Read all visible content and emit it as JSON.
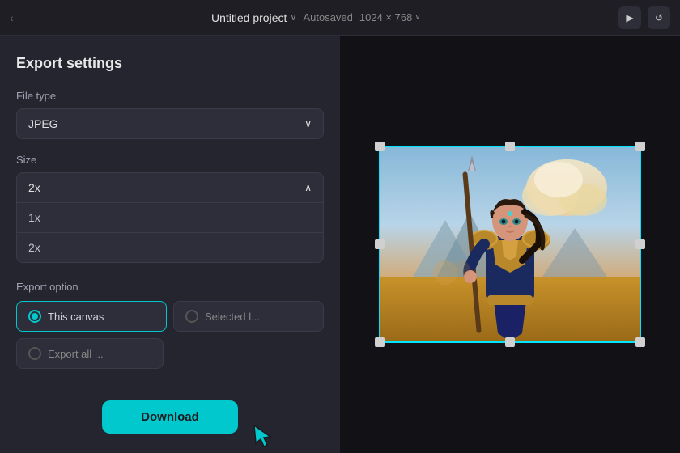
{
  "topbar": {
    "back_chevron": "‹",
    "project_name": "Untitled project",
    "project_chevron": "∨",
    "autosaved": "Autosaved",
    "canvas_size": "1024 × 768",
    "canvas_size_chevron": "∨"
  },
  "panel": {
    "title": "Export settings",
    "file_type_label": "File type",
    "file_type_value": "JPEG",
    "size_label": "Size",
    "size_value": "2x",
    "size_options": [
      {
        "label": "1x"
      },
      {
        "label": "2x"
      }
    ],
    "export_option_label": "Export option",
    "option_canvas": "This canvas",
    "option_selected": "Selected l...",
    "option_export_all": "Export all ..."
  },
  "download_btn": {
    "label": "Download"
  },
  "icons": {
    "chevron_down": "∨",
    "chevron_up": "∧",
    "radio_checked": "●",
    "play": "▶",
    "rotate": "↺"
  }
}
